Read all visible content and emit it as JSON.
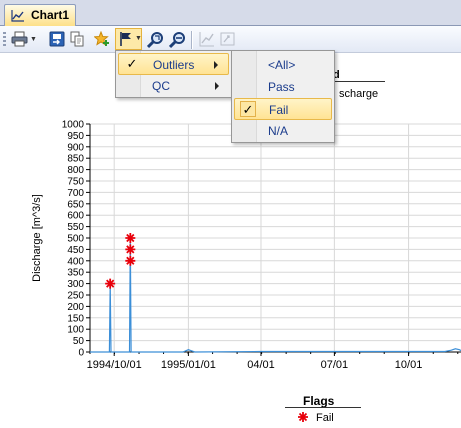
{
  "tab": {
    "label": "Chart1",
    "icon": "line-chart-icon"
  },
  "toolbar": {
    "buttons": [
      "print-icon",
      "export-icon",
      "copy-icon",
      "favorite-add-icon",
      "flag-icon",
      "zoom-reset-icon",
      "zoom-out-icon",
      "series-icon",
      "properties-icon"
    ]
  },
  "flag_menu": {
    "items": [
      {
        "label": "Outliers",
        "checked": true,
        "submenu": true
      },
      {
        "label": "QC",
        "checked": false,
        "submenu": true
      }
    ]
  },
  "outliers_submenu": {
    "items": [
      {
        "label": "<All>",
        "checked": false
      },
      {
        "label": "Pass",
        "checked": false
      },
      {
        "label": "Fail",
        "checked": true
      },
      {
        "label": "N/A",
        "checked": false
      }
    ]
  },
  "legend_top": {
    "title_fragment": "d",
    "item_fragment": "scharge"
  },
  "flags_legend": {
    "title": "Flags",
    "item": "Fail",
    "marker_color": "#e8000b"
  },
  "colors": {
    "series": "#3c8fd8",
    "flag": "#e8000b",
    "grid": "#d8d8d8",
    "highlight": "#ffe394"
  },
  "chart_data": {
    "type": "line",
    "ylabel": "Discharge [m^3/s]",
    "ylim": [
      0,
      1000
    ],
    "yticks": [
      0,
      50,
      100,
      150,
      200,
      250,
      300,
      350,
      400,
      450,
      500,
      550,
      600,
      650,
      700,
      750,
      800,
      850,
      900,
      950,
      1000
    ],
    "xticks": [
      "1994/10/01",
      "1995/01/01",
      "04/01",
      "07/01",
      "10/01"
    ],
    "xticks_days": [
      0,
      92,
      182,
      273,
      365
    ],
    "xlim_days": [
      -30,
      430
    ],
    "series": [
      {
        "x_days": [
          -30,
          -10,
          -6,
          -5,
          -4,
          0,
          10,
          19,
          20,
          21,
          25,
          30,
          60,
          85,
          88,
          92,
          95,
          100,
          182,
          273,
          365,
          410,
          418,
          423,
          428,
          430
        ],
        "values": [
          0,
          0,
          0,
          300,
          0,
          0,
          0,
          0,
          500,
          0,
          0,
          0,
          0,
          0,
          4,
          10,
          6,
          0,
          2,
          2,
          2,
          2,
          8,
          14,
          10,
          6
        ]
      }
    ],
    "flags": [
      {
        "x_day": -5,
        "value": 300,
        "flag": "Fail"
      },
      {
        "x_day": 20,
        "value": 400,
        "flag": "Fail"
      },
      {
        "x_day": 20,
        "value": 450,
        "flag": "Fail"
      },
      {
        "x_day": 20,
        "value": 500,
        "flag": "Fail"
      }
    ]
  }
}
